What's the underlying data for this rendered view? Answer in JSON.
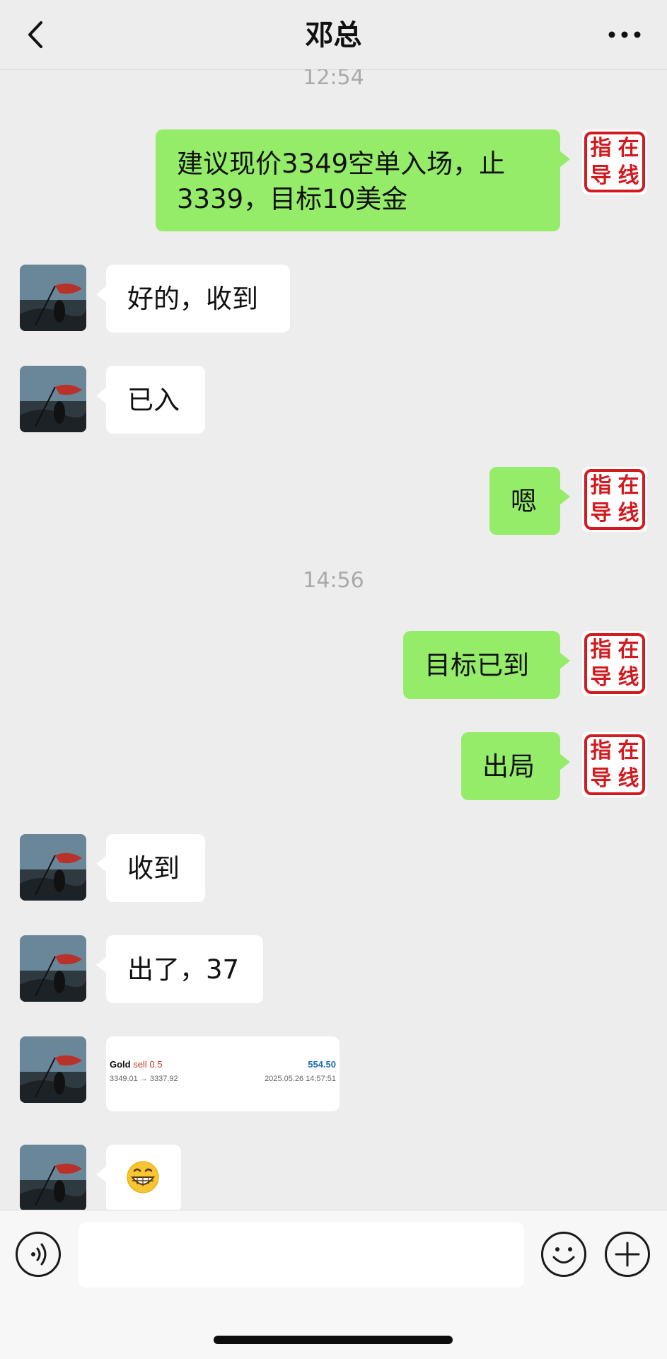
{
  "header": {
    "title": "邓总"
  },
  "avatar_self": {
    "seal_chars": [
      "指",
      "在",
      "导",
      "线"
    ],
    "color": "#d21a1f"
  },
  "messages": [
    {
      "type": "time",
      "text": "12:54"
    },
    {
      "type": "text",
      "from": "me",
      "text": "建议现价3349空单入场，止3339，目标10美金"
    },
    {
      "type": "text",
      "from": "them",
      "text": "好的，收到"
    },
    {
      "type": "text",
      "from": "them",
      "text": "已入"
    },
    {
      "type": "text",
      "from": "me",
      "text": "嗯"
    },
    {
      "type": "time",
      "text": "14:56"
    },
    {
      "type": "text",
      "from": "me",
      "text": "目标已到"
    },
    {
      "type": "text",
      "from": "me",
      "text": "出局"
    },
    {
      "type": "text",
      "from": "them",
      "text": "收到"
    },
    {
      "type": "text",
      "from": "them",
      "text": "出了，37"
    },
    {
      "type": "trade_card",
      "from": "them",
      "symbol": "Gold",
      "side": "sell 0.5",
      "prices": "3349.01 → 3337.92",
      "profit": "554.50",
      "datetime": "2025.05.26 14:57:51"
    },
    {
      "type": "emoji",
      "from": "them",
      "text": "😁"
    }
  ],
  "input": {
    "placeholder": ""
  },
  "colors": {
    "bubble_me": "#95ec69",
    "bubble_them": "#ffffff",
    "background": "#ededed"
  },
  "icons": [
    "back-chevron-icon",
    "more-dots-icon",
    "voice-icon",
    "emoji-icon",
    "plus-icon"
  ]
}
